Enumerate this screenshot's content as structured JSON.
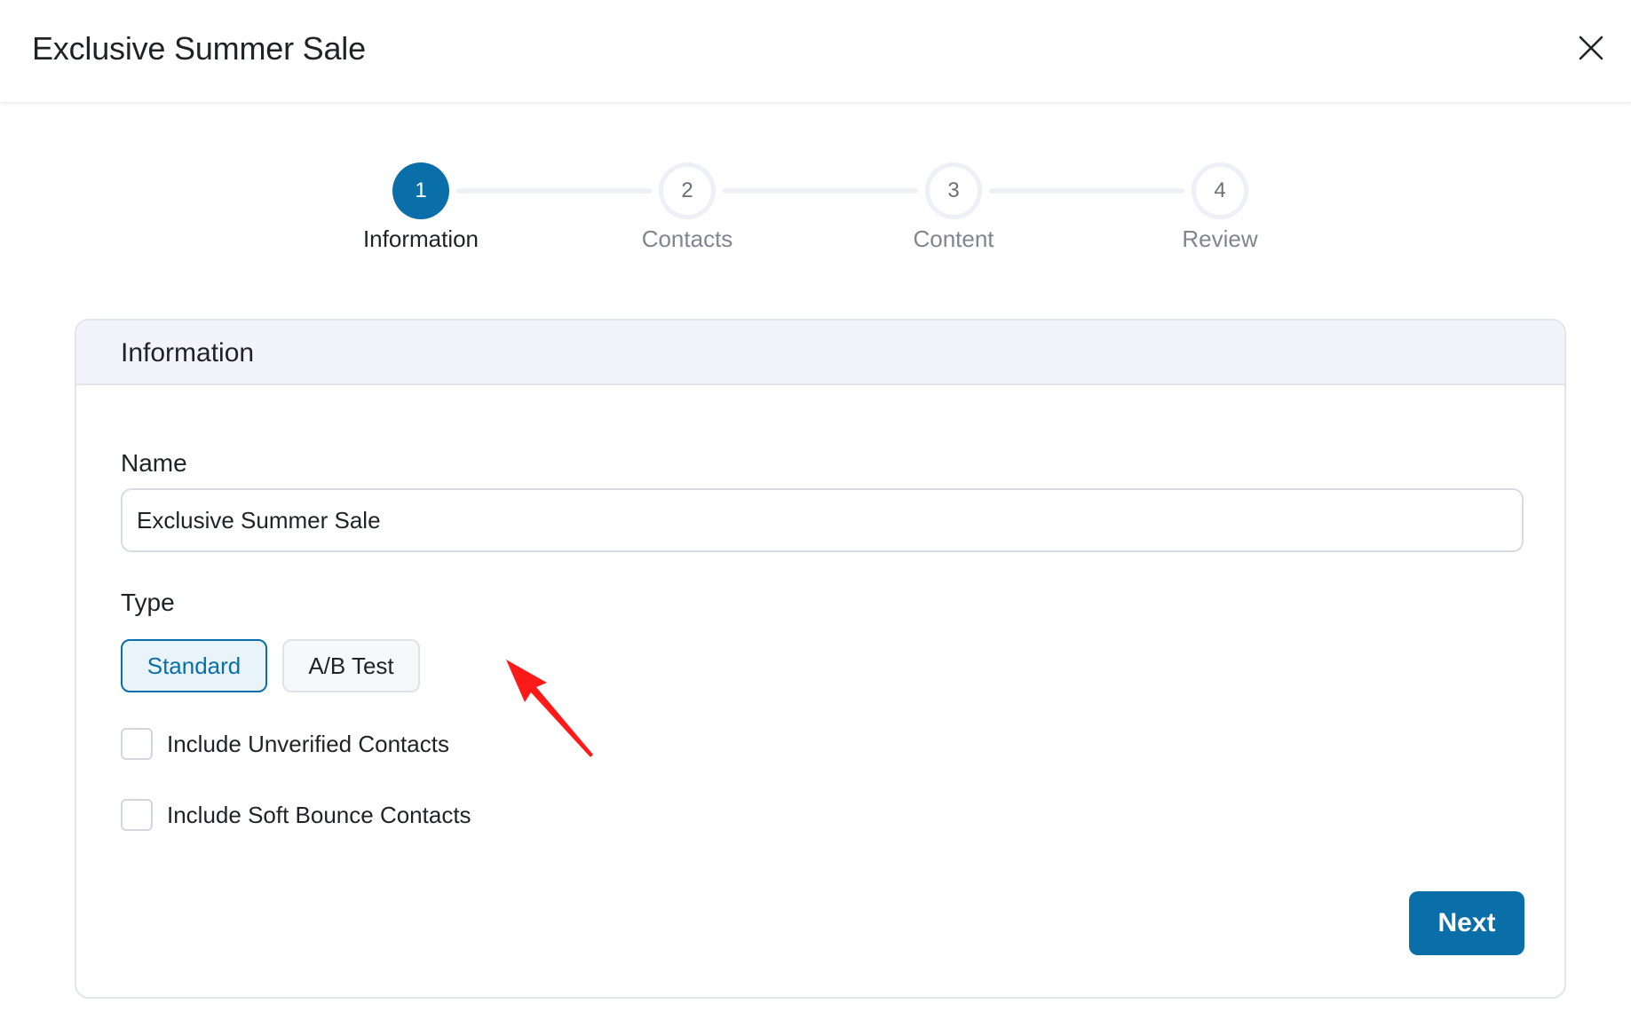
{
  "header": {
    "title": "Exclusive Summer Sale",
    "close_icon": "close-icon"
  },
  "stepper": {
    "steps": [
      {
        "number": "1",
        "label": "Information",
        "state": "active"
      },
      {
        "number": "2",
        "label": "Contacts",
        "state": "inactive"
      },
      {
        "number": "3",
        "label": "Content",
        "state": "inactive"
      },
      {
        "number": "4",
        "label": "Review",
        "state": "inactive"
      }
    ]
  },
  "card": {
    "title": "Information",
    "name_label": "Name",
    "name_value": "Exclusive Summer Sale",
    "type_label": "Type",
    "type_options": [
      {
        "label": "Standard",
        "selected": true
      },
      {
        "label": "A/B Test",
        "selected": false
      }
    ],
    "checkboxes": [
      {
        "label": "Include Unverified Contacts",
        "checked": false
      },
      {
        "label": "Include Soft Bounce Contacts",
        "checked": false
      }
    ],
    "next_label": "Next"
  },
  "colors": {
    "primary": "#0a6fa8",
    "annotation": "#ff1a1a"
  }
}
